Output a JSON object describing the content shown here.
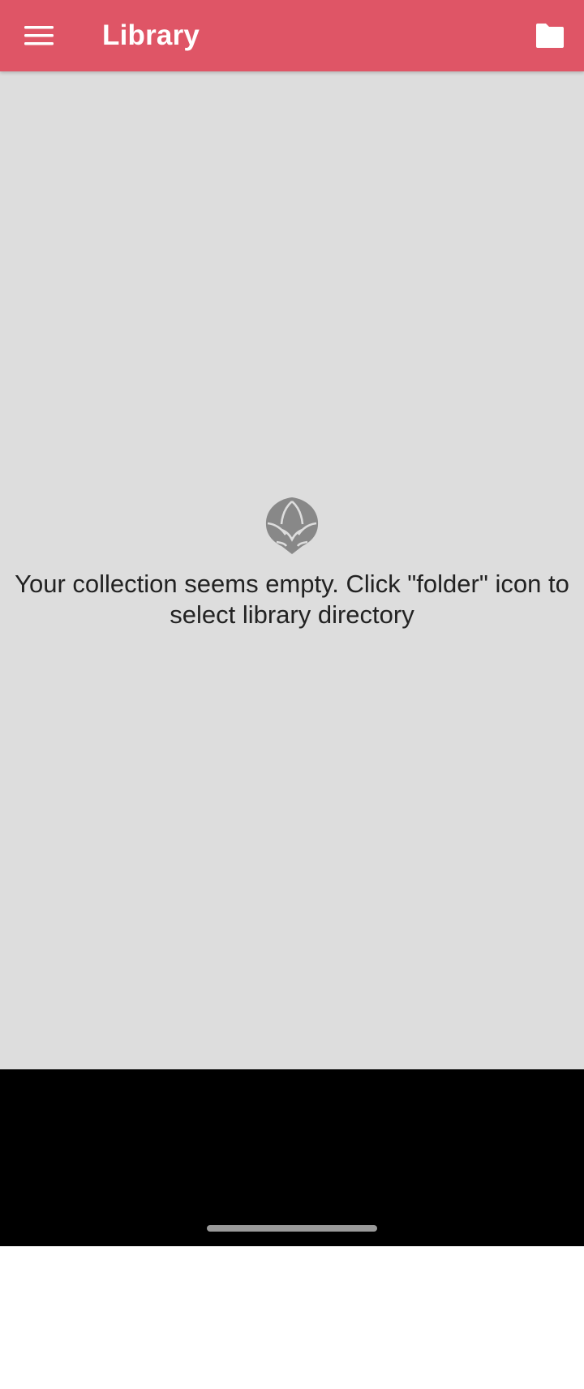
{
  "app_bar": {
    "title": "Library",
    "color": "#df5566",
    "menu_icon": "hamburger-menu-icon",
    "folder_icon": "folder-icon"
  },
  "empty_state": {
    "icon": "hop-cone-icon",
    "message": "Your collection seems empty. Click \"folder\" icon to select library directory"
  },
  "colors": {
    "content_background": "#dddddd",
    "nav_bar_background": "#000000",
    "icon_gray": "#888888"
  }
}
